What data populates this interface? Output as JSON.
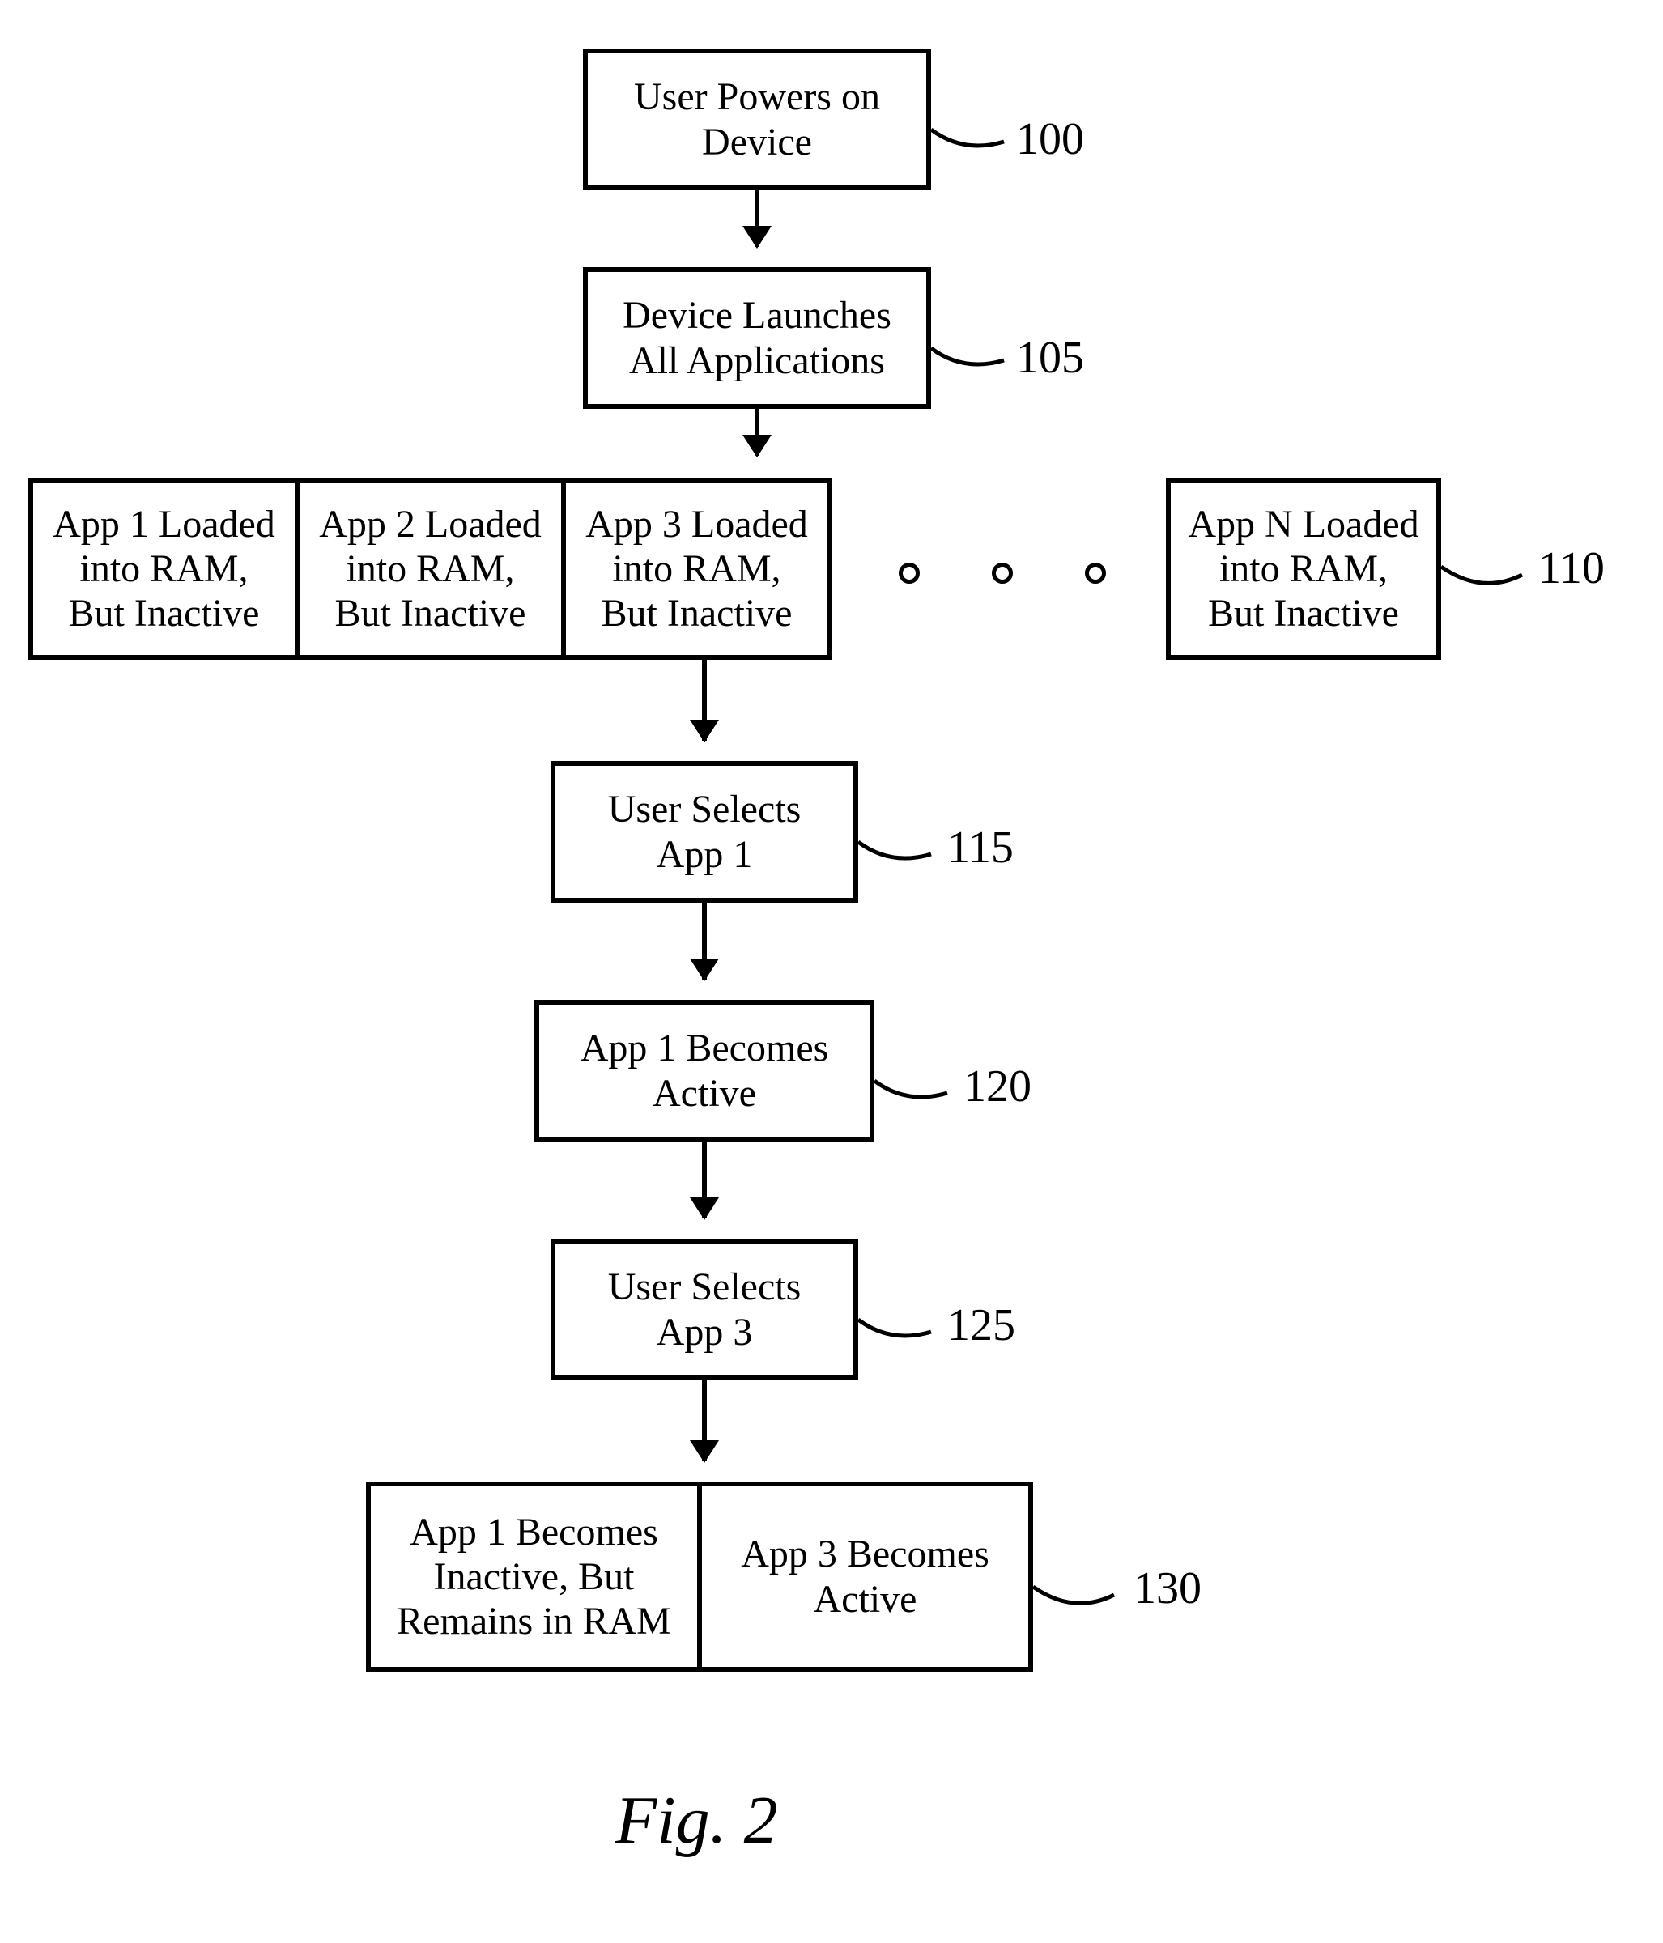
{
  "nodes": {
    "n100": "User Powers on\nDevice",
    "n105": "Device Launches\nAll Applications",
    "n110a": "App 1 Loaded\ninto RAM,\nBut Inactive",
    "n110b": "App 2 Loaded\ninto RAM,\nBut Inactive",
    "n110c": "App 3 Loaded\ninto RAM,\nBut Inactive",
    "n110n": "App N Loaded\ninto RAM,\nBut Inactive",
    "n115": "User Selects\nApp 1",
    "n120": "App 1 Becomes\nActive",
    "n125": "User Selects\nApp 3",
    "n130a": "App 1 Becomes\nInactive, But\nRemains in RAM",
    "n130b": "App 3 Becomes\nActive"
  },
  "labels": {
    "l100": "100",
    "l105": "105",
    "l110": "110",
    "l115": "115",
    "l120": "120",
    "l125": "125",
    "l130": "130"
  },
  "caption": "Fig. 2"
}
